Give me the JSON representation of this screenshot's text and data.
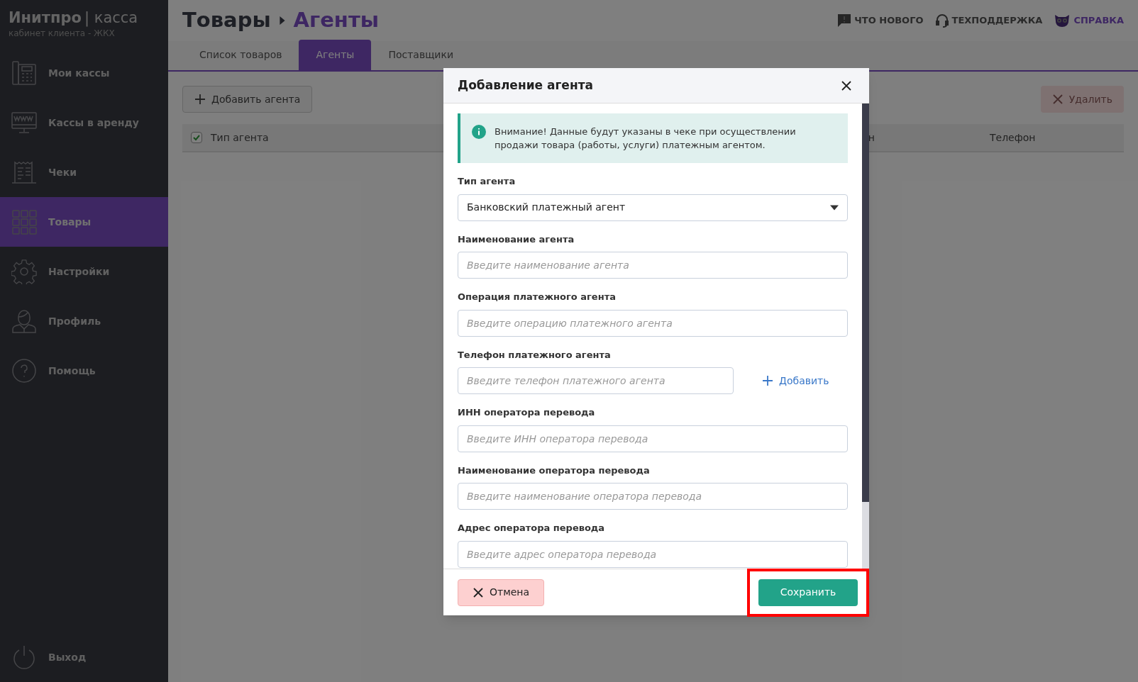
{
  "brand": {
    "name": "Инитпро",
    "separator": "|",
    "product": "касса",
    "subtitle": "кабинет клиента - ЖКХ"
  },
  "sidebar": {
    "items": [
      {
        "kind": "register",
        "label": "Мои кассы",
        "selected": false
      },
      {
        "kind": "rent",
        "label": "Кассы в аренду",
        "selected": false
      },
      {
        "kind": "receipt",
        "label": "Чеки",
        "selected": false
      },
      {
        "kind": "grid",
        "label": "Товары",
        "selected": true
      },
      {
        "kind": "gear",
        "label": "Настройки",
        "selected": false
      },
      {
        "kind": "person",
        "label": "Профиль",
        "selected": false
      },
      {
        "kind": "help",
        "label": "Помощь",
        "selected": false
      }
    ],
    "logout": "Выход"
  },
  "header": {
    "breadcrumb": [
      "Товары",
      "Агенты"
    ],
    "links": [
      {
        "kind": "news",
        "label": "ЧТО НОВОГО"
      },
      {
        "kind": "support",
        "label": "ТЕХПОДДЕРЖКА"
      },
      {
        "kind": "help",
        "label": "СПРАВКА"
      }
    ]
  },
  "tabs": [
    {
      "label": "Список товаров",
      "selected": false
    },
    {
      "label": "Агенты",
      "selected": true
    },
    {
      "label": "Поставщики",
      "selected": false
    }
  ],
  "toolbar": {
    "add": "Добавить агента",
    "delete": "Удалить"
  },
  "table": {
    "select_all_checked": true,
    "columns": [
      "Тип агента",
      "н",
      "Телефон"
    ]
  },
  "dialog": {
    "title": "Добавление агента",
    "notice": "Внимание! Данные будут указаны в чеке при осуществлении продажи товара (работы, услуги) платежным агентом.",
    "fields": [
      {
        "kind": "select",
        "label": "Тип агента",
        "value": "Банковский платежный агент"
      },
      {
        "kind": "text",
        "label": "Наименование агента",
        "placeholder": "Введите наименование агента"
      },
      {
        "kind": "text",
        "label": "Операция платежного агента",
        "placeholder": "Введите операцию платежного агента"
      },
      {
        "kind": "phone",
        "label": "Телефон платежного агента",
        "placeholder": "Введите телефон платежного агента",
        "add": "Добавить"
      },
      {
        "kind": "text",
        "label": "ИНН оператора перевода",
        "placeholder": "Введите ИНН оператора перевода"
      },
      {
        "kind": "text",
        "label": "Наименование оператора перевода",
        "placeholder": "Введите наименование оператора перевода"
      },
      {
        "kind": "text",
        "label": "Адрес оператора перевода",
        "placeholder": "Введите адрес оператора перевода"
      }
    ],
    "cancel": "Отмена",
    "save": "Сохранить",
    "save_highlighted": true
  }
}
